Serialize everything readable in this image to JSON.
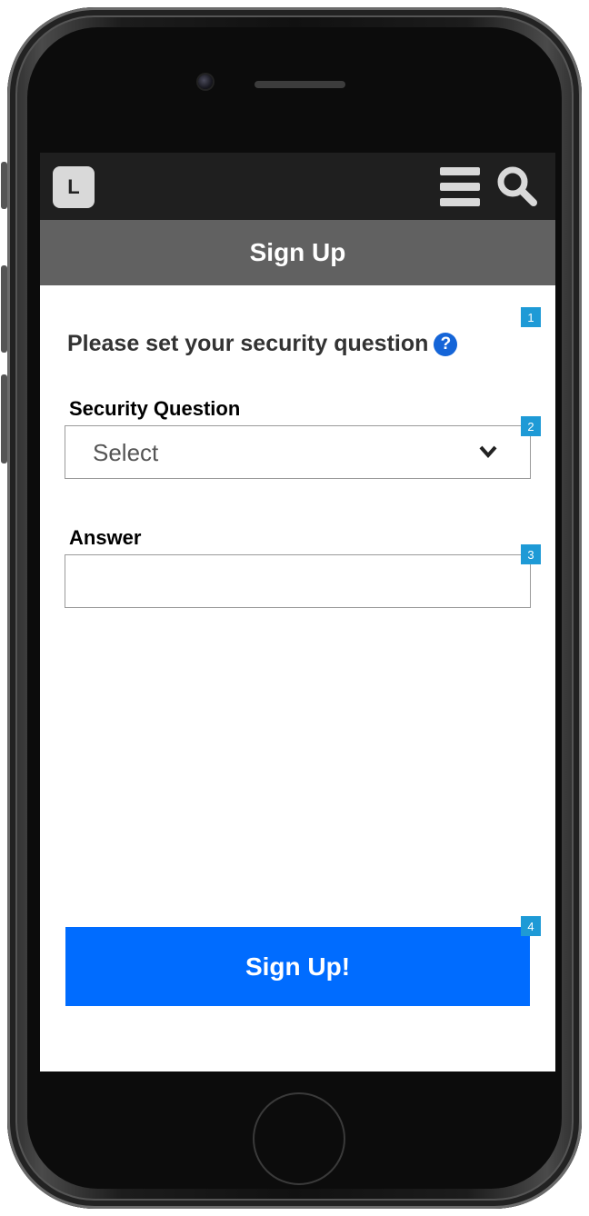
{
  "header": {
    "logo_letter": "L",
    "menu_icon": "hamburger-menu-icon",
    "search_icon": "search-icon"
  },
  "page": {
    "title": "Sign Up"
  },
  "form": {
    "prompt": "Please set your security question",
    "help_icon": "?",
    "security_question_label": "Security Question",
    "security_question_value": "Select",
    "answer_label": "Answer",
    "answer_value": "",
    "submit_label": "Sign Up!"
  },
  "annotations": {
    "badge_1": "1",
    "badge_2": "2",
    "badge_3": "3",
    "badge_4": "4"
  },
  "colors": {
    "topbar": "#1f1f1f",
    "titlebar": "#616161",
    "primary_button": "#006cff",
    "help_icon": "#1565d8",
    "annotation_badge": "#1e9ad6"
  }
}
